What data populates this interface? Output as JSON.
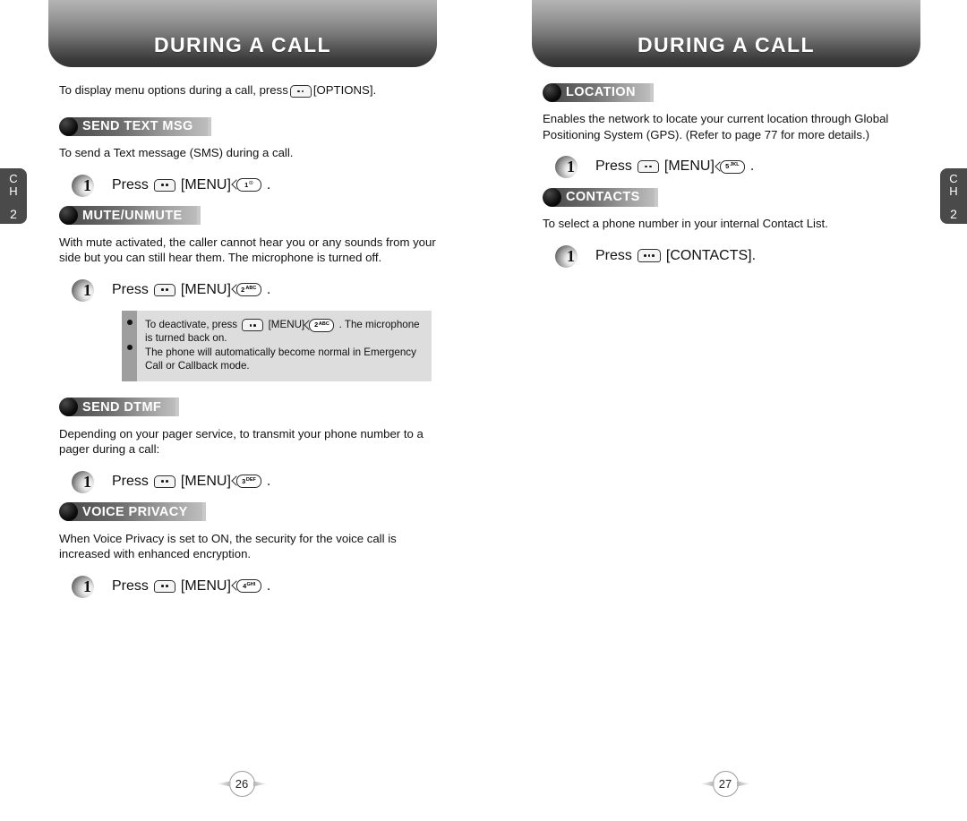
{
  "colors": {
    "banner_top": "#b4b4b4",
    "banner_bottom": "#343434",
    "heading_gradient_start": "#4c4c4c",
    "heading_gradient_end": "#bdbdbd",
    "side_tab": "#4a4a4a",
    "note_bg": "#dddddd",
    "note_rail": "#9e9e9e"
  },
  "side_tab": {
    "line1": "C",
    "line2": "H",
    "number": "2"
  },
  "left_page": {
    "banner_title": "DURING A CALL",
    "page_number": "26",
    "intro": {
      "before_key": "To display menu options during a call, press",
      "key": {
        "type": "soft-key",
        "dots": 2,
        "name": "options-key"
      },
      "after_key": "[OPTIONS]."
    },
    "sections": [
      {
        "id": "send-text-msg",
        "heading": "SEND TEXT MSG",
        "body": "To send a Text message (SMS) during a call.",
        "step": {
          "number": "1",
          "press_label": "Press",
          "menu_key": {
            "type": "soft-key",
            "dots": 2
          },
          "menu_label": "[MENU]",
          "num_key": {
            "digit": "1",
            "sub": "☉"
          },
          "period": "."
        }
      },
      {
        "id": "mute-unmute",
        "heading": "MUTE/UNMUTE",
        "body": "With mute activated, the caller cannot hear you or any sounds from your side but you can still hear them. The microphone is turned off.",
        "step": {
          "number": "1",
          "press_label": "Press",
          "menu_key": {
            "type": "soft-key",
            "dots": 2
          },
          "menu_label": "[MENU]",
          "num_key": {
            "digit": "2",
            "sub": "ABC"
          },
          "period": "."
        },
        "note": {
          "items": [
            {
              "before_key": "To deactivate, press",
              "menu_key": {
                "type": "soft-key",
                "dots": 2
              },
              "menu_label": "[MENU]",
              "num_key": {
                "digit": "2",
                "sub": "ABC"
              },
              "after_key": ". The microphone is turned back on."
            },
            {
              "text": "The phone will automatically become normal in Emergency Call or Callback mode."
            }
          ]
        }
      },
      {
        "id": "send-dtmf",
        "heading": "SEND DTMF",
        "body": "Depending on your pager service, to transmit your phone number to a pager during a call:",
        "step": {
          "number": "1",
          "press_label": "Press",
          "menu_key": {
            "type": "soft-key",
            "dots": 2
          },
          "menu_label": "[MENU]",
          "num_key": {
            "digit": "3",
            "sub": "DEF"
          },
          "period": "."
        }
      },
      {
        "id": "voice-privacy",
        "heading": "VOICE PRIVACY",
        "body": "When Voice Privacy is set to ON, the security for the voice call is increased with enhanced encryption.",
        "step": {
          "number": "1",
          "press_label": "Press",
          "menu_key": {
            "type": "soft-key",
            "dots": 2
          },
          "menu_label": "[MENU]",
          "num_key": {
            "digit": "4",
            "sub": "GHI"
          },
          "period": "."
        }
      }
    ]
  },
  "right_page": {
    "banner_title": "DURING A CALL",
    "page_number": "27",
    "sections": [
      {
        "id": "location",
        "heading": "LOCATION",
        "body": "Enables the network to locate your current location through Global Positioning System (GPS). (Refer to page 77 for more details.)",
        "step": {
          "number": "1",
          "press_label": "Press",
          "menu_key": {
            "type": "soft-key",
            "dots": 2
          },
          "menu_label": "[MENU]",
          "num_key": {
            "digit": "5",
            "sub": "JKL"
          },
          "period": "."
        }
      },
      {
        "id": "contacts",
        "heading": "CONTACTS",
        "body": "To select a phone number in your internal Contact List.",
        "step": {
          "number": "1",
          "press_label": "Press",
          "menu_key": {
            "type": "soft-key",
            "dots": 3
          },
          "menu_label": "[CONTACTS].",
          "num_key": null,
          "period": ""
        }
      }
    ]
  }
}
